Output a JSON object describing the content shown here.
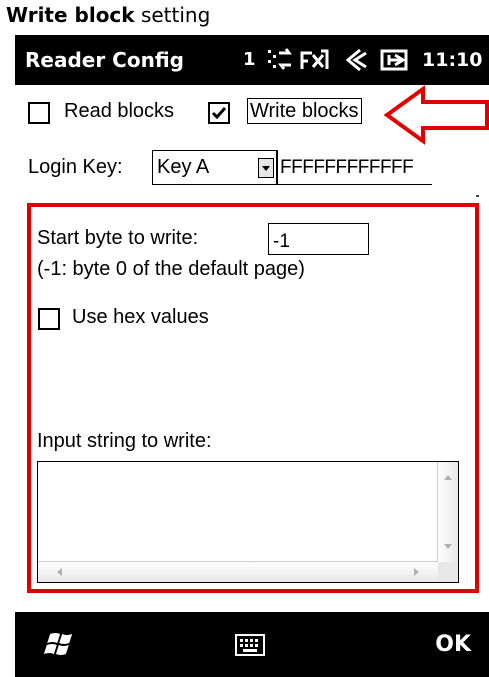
{
  "caption": {
    "bold": "Write block",
    "rest": " setting"
  },
  "titlebar": {
    "app_title": "Reader Config",
    "signal_text": "1",
    "time": "11:10",
    "icons": [
      "data-sync-icon",
      "no-signal-icon",
      "speaker-icon",
      "battery-charging-icon"
    ]
  },
  "options": {
    "read_blocks": {
      "label": "Read blocks",
      "checked": false
    },
    "write_blocks": {
      "label": "Write blocks",
      "checked": true
    }
  },
  "login": {
    "label": "Login Key:",
    "key_select": "Key A",
    "key_value": "FFFFFFFFFFFF"
  },
  "write_panel": {
    "start_byte_label": "Start byte to write:",
    "start_byte_value": "-1",
    "hint": "(-1: byte 0 of the default page)",
    "use_hex_label": "Use hex values",
    "use_hex_checked": false,
    "input_label": "Input string to write:",
    "input_value": ""
  },
  "bottombar": {
    "ok_label": "OK",
    "icons": [
      "windows-start-icon",
      "keyboard-icon"
    ]
  },
  "colors": {
    "highlight": "#e00000",
    "bar": "#000000"
  }
}
